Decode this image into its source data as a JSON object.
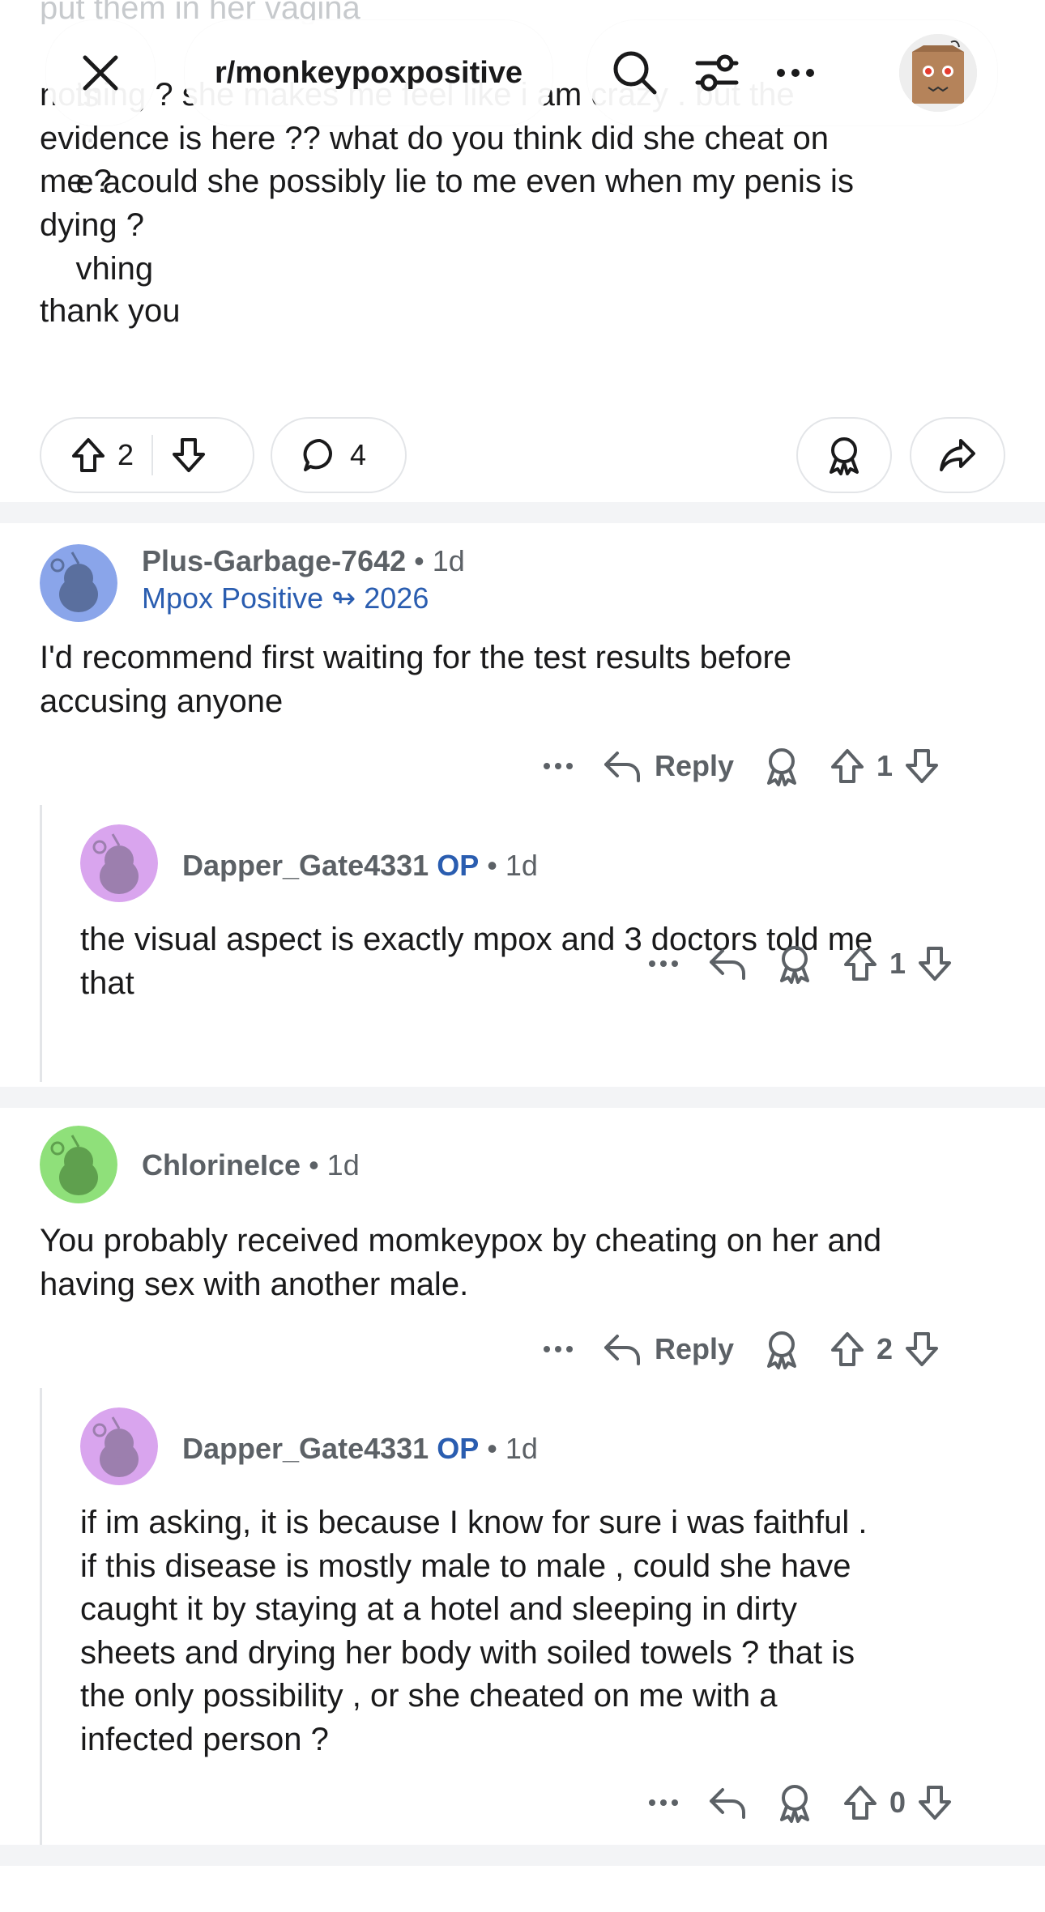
{
  "header": {
    "subreddit": "r/monkeypoxpositive"
  },
  "post": {
    "cut_line": "put them in her vagina",
    "obscured_line_start": "is",
    "obscured_line_mid": "e a",
    "obscured_line_end": "vhing",
    "lines": [
      "nothing ? she makes me feel like i am crazy . but the",
      "evidence is here ?? what do you think did she cheat on",
      "me ? could she possibly lie to me even when my penis is",
      "dying ?"
    ],
    "closing": "thank you",
    "votes": "2",
    "comments": "4"
  },
  "comments": [
    {
      "author": "Plus-Garbage-7642",
      "time": "1d",
      "flair": "Mpox Positive ↬ 2026",
      "text_lines": [
        "I'd recommend first waiting for the test results before",
        "accusing anyone"
      ],
      "reply_label": "Reply",
      "votes": "1",
      "avatar_color": "#8aa5ea"
    },
    {
      "author": "Dapper_Gate4331",
      "op_label": "OP",
      "time": "1d",
      "text_lines": [
        "the visual aspect is exactly mpox and 3 doctors told me",
        "that"
      ],
      "votes": "1",
      "avatar_color": "#d9a5ee"
    },
    {
      "author": "ChlorineIce",
      "time": "1d",
      "text_lines": [
        "You probably received momkeypox by cheating on her and",
        "having sex with another male."
      ],
      "reply_label": "Reply",
      "votes": "2",
      "avatar_color": "#8fe07a"
    },
    {
      "author": "Dapper_Gate4331",
      "op_label": "OP",
      "time": "1d",
      "text_lines": [
        "if im asking, it is because I know for sure i was faithful .",
        "if this disease is mostly male to male , could she have",
        "caught it by staying at a hotel and sleeping in dirty",
        "sheets and drying her body with soiled towels ? that is",
        "the only possibility , or she cheated on me with a",
        "infected person ?"
      ],
      "votes": "0",
      "avatar_color": "#d9a5ee"
    }
  ],
  "icons": {
    "close": "close-icon",
    "search": "search-icon",
    "filter": "filter-icon",
    "more": "more-icon",
    "upvote": "upvote-arrow-icon",
    "downvote": "downvote-arrow-icon",
    "comment": "comment-bubble-icon",
    "award": "award-icon",
    "share": "share-arrow-icon",
    "reply": "reply-arrow-icon"
  },
  "colors": {
    "op": "#2a5db0",
    "meta": "#5c6166",
    "border": "#e3e5e8"
  }
}
